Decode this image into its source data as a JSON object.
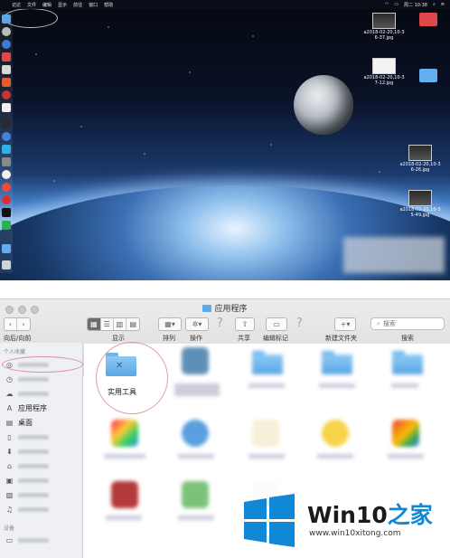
{
  "menubar": {
    "items": [
      "访达",
      "文件",
      "编辑",
      "显示",
      "前往",
      "窗口",
      "帮助"
    ],
    "clock": "周二 10:38"
  },
  "desktop": {
    "files": [
      {
        "label": "a2018-02-20,10-3\n6-37.jpg"
      },
      {
        "label": "a2018-02-20,10-3\n7-12.jpg"
      },
      {
        "label": "a2018-02-20,10-3\n6-26.jpg"
      },
      {
        "label": "a2018-02-20,10-3\n5-49.jpg"
      }
    ]
  },
  "finder": {
    "window_title": "应用程序",
    "toolbar": {
      "nav_label": "向后/向前",
      "view_label": "显示",
      "arrange_label": "排列",
      "action_label": "操作",
      "share_label": "共享",
      "tags_label": "编辑标记",
      "new_folder_label": "新建文件夹",
      "search_label": "搜索",
      "search_placeholder": "搜索"
    },
    "sidebar": {
      "favorites_header": "个人收藏",
      "applications": "应用程序",
      "desktop": "桌面",
      "devices_header": "设备"
    },
    "items": {
      "utilities": "实用工具"
    }
  },
  "watermark": {
    "brand_a": "Win10",
    "brand_b": "之家",
    "url": "www.win10xitong.com"
  },
  "colors": {
    "folder_blue": "#5fa9e8",
    "win_blue": "#1187d8",
    "highlight": "#cd5078"
  }
}
